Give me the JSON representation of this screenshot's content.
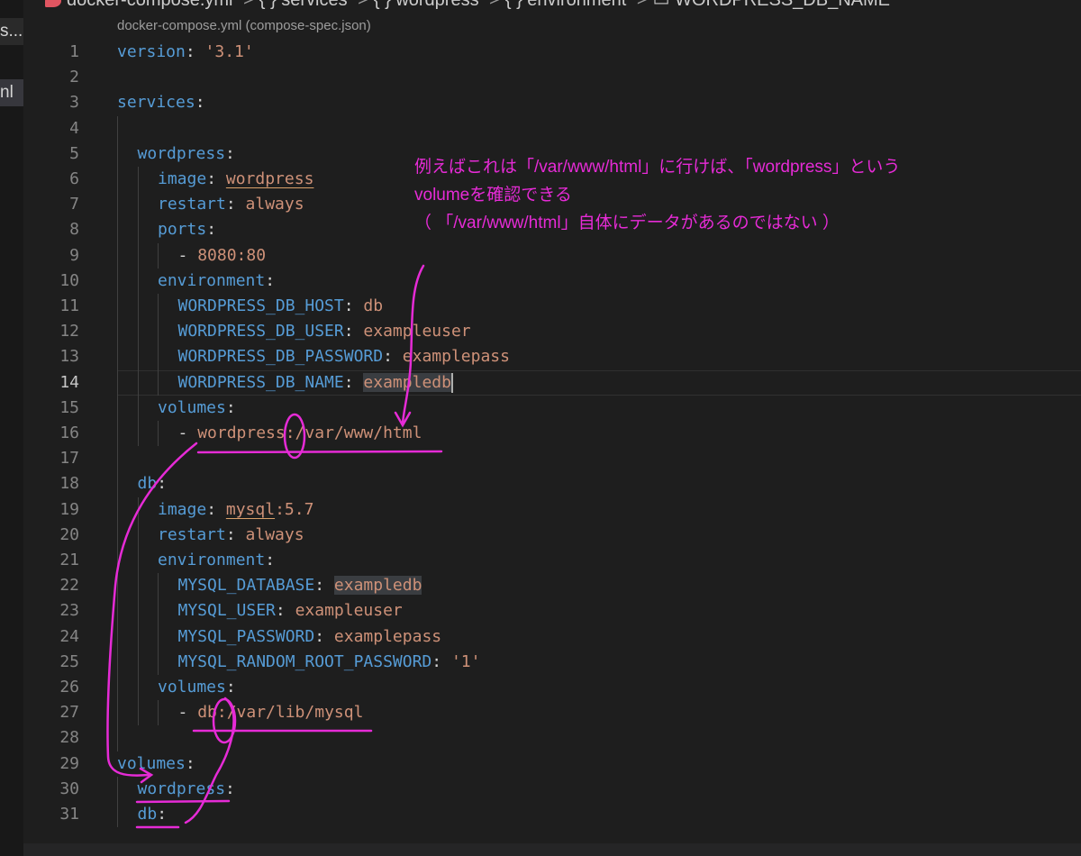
{
  "left_tabs": [
    "s...",
    "nl"
  ],
  "breadcrumb": {
    "file": "docker-compose.yml",
    "items": [
      "{ } services",
      "{ } wordpress",
      "{ } environment",
      "▭ WORDPRESS_DB_NAME"
    ]
  },
  "schema_hint": "docker-compose.yml (compose-spec.json)",
  "code_lines": [
    {
      "n": "1",
      "indent": 0,
      "key": "version",
      "value": "'3.1'"
    },
    {
      "n": "2"
    },
    {
      "n": "3",
      "indent": 0,
      "key": "services",
      "value": ""
    },
    {
      "n": "4"
    },
    {
      "n": "5",
      "indent": 1,
      "key": "wordpress",
      "value": ""
    },
    {
      "n": "6",
      "indent": 2,
      "key": "image",
      "value": "wordpress",
      "squiggle": true
    },
    {
      "n": "7",
      "indent": 2,
      "key": "restart",
      "value": "always"
    },
    {
      "n": "8",
      "indent": 2,
      "key": "ports",
      "value": ""
    },
    {
      "n": "9",
      "indent": 3,
      "item": "8080:80"
    },
    {
      "n": "10",
      "indent": 2,
      "key": "environment",
      "value": ""
    },
    {
      "n": "11",
      "indent": 3,
      "key": "WORDPRESS_DB_HOST",
      "value": "db"
    },
    {
      "n": "12",
      "indent": 3,
      "key": "WORDPRESS_DB_USER",
      "value": "exampleuser"
    },
    {
      "n": "13",
      "indent": 3,
      "key": "WORDPRESS_DB_PASSWORD",
      "value": "examplepass"
    },
    {
      "n": "14",
      "indent": 3,
      "key": "WORDPRESS_DB_NAME",
      "value": "exampledb",
      "highlight": true,
      "active": true,
      "cursor": true
    },
    {
      "n": "15",
      "indent": 2,
      "key": "volumes",
      "value": ""
    },
    {
      "n": "16",
      "indent": 3,
      "item": "wordpress:/var/www/html"
    },
    {
      "n": "17"
    },
    {
      "n": "18",
      "indent": 1,
      "key": "db",
      "value": ""
    },
    {
      "n": "19",
      "indent": 2,
      "key": "image",
      "value": "mysql",
      "squiggle": true,
      "suffix": ":5.7"
    },
    {
      "n": "20",
      "indent": 2,
      "key": "restart",
      "value": "always"
    },
    {
      "n": "21",
      "indent": 2,
      "key": "environment",
      "value": ""
    },
    {
      "n": "22",
      "indent": 3,
      "key": "MYSQL_DATABASE",
      "value": "exampledb",
      "highlight": true
    },
    {
      "n": "23",
      "indent": 3,
      "key": "MYSQL_USER",
      "value": "exampleuser"
    },
    {
      "n": "24",
      "indent": 3,
      "key": "MYSQL_PASSWORD",
      "value": "examplepass"
    },
    {
      "n": "25",
      "indent": 3,
      "key": "MYSQL_RANDOM_ROOT_PASSWORD",
      "value": "'1'"
    },
    {
      "n": "26",
      "indent": 2,
      "key": "volumes",
      "value": ""
    },
    {
      "n": "27",
      "indent": 3,
      "item": "db:/var/lib/mysql"
    },
    {
      "n": "28"
    },
    {
      "n": "29",
      "indent": 0,
      "key": "volumes",
      "value": ""
    },
    {
      "n": "30",
      "indent": 1,
      "key": "wordpress",
      "value": ""
    },
    {
      "n": "31",
      "indent": 1,
      "key": "db",
      "value": ""
    }
  ],
  "annotation": {
    "lines": [
      "例えばこれは「/var/www/html」に行けば、「wordpress」という",
      "volumeを確認できる",
      "（ 「/var/www/html」自体にデータがあるのではない ）"
    ],
    "color": "#e62bd6"
  },
  "colors": {
    "key": "#569cd6",
    "string": "#ce9178",
    "background": "#1e1e1e"
  }
}
